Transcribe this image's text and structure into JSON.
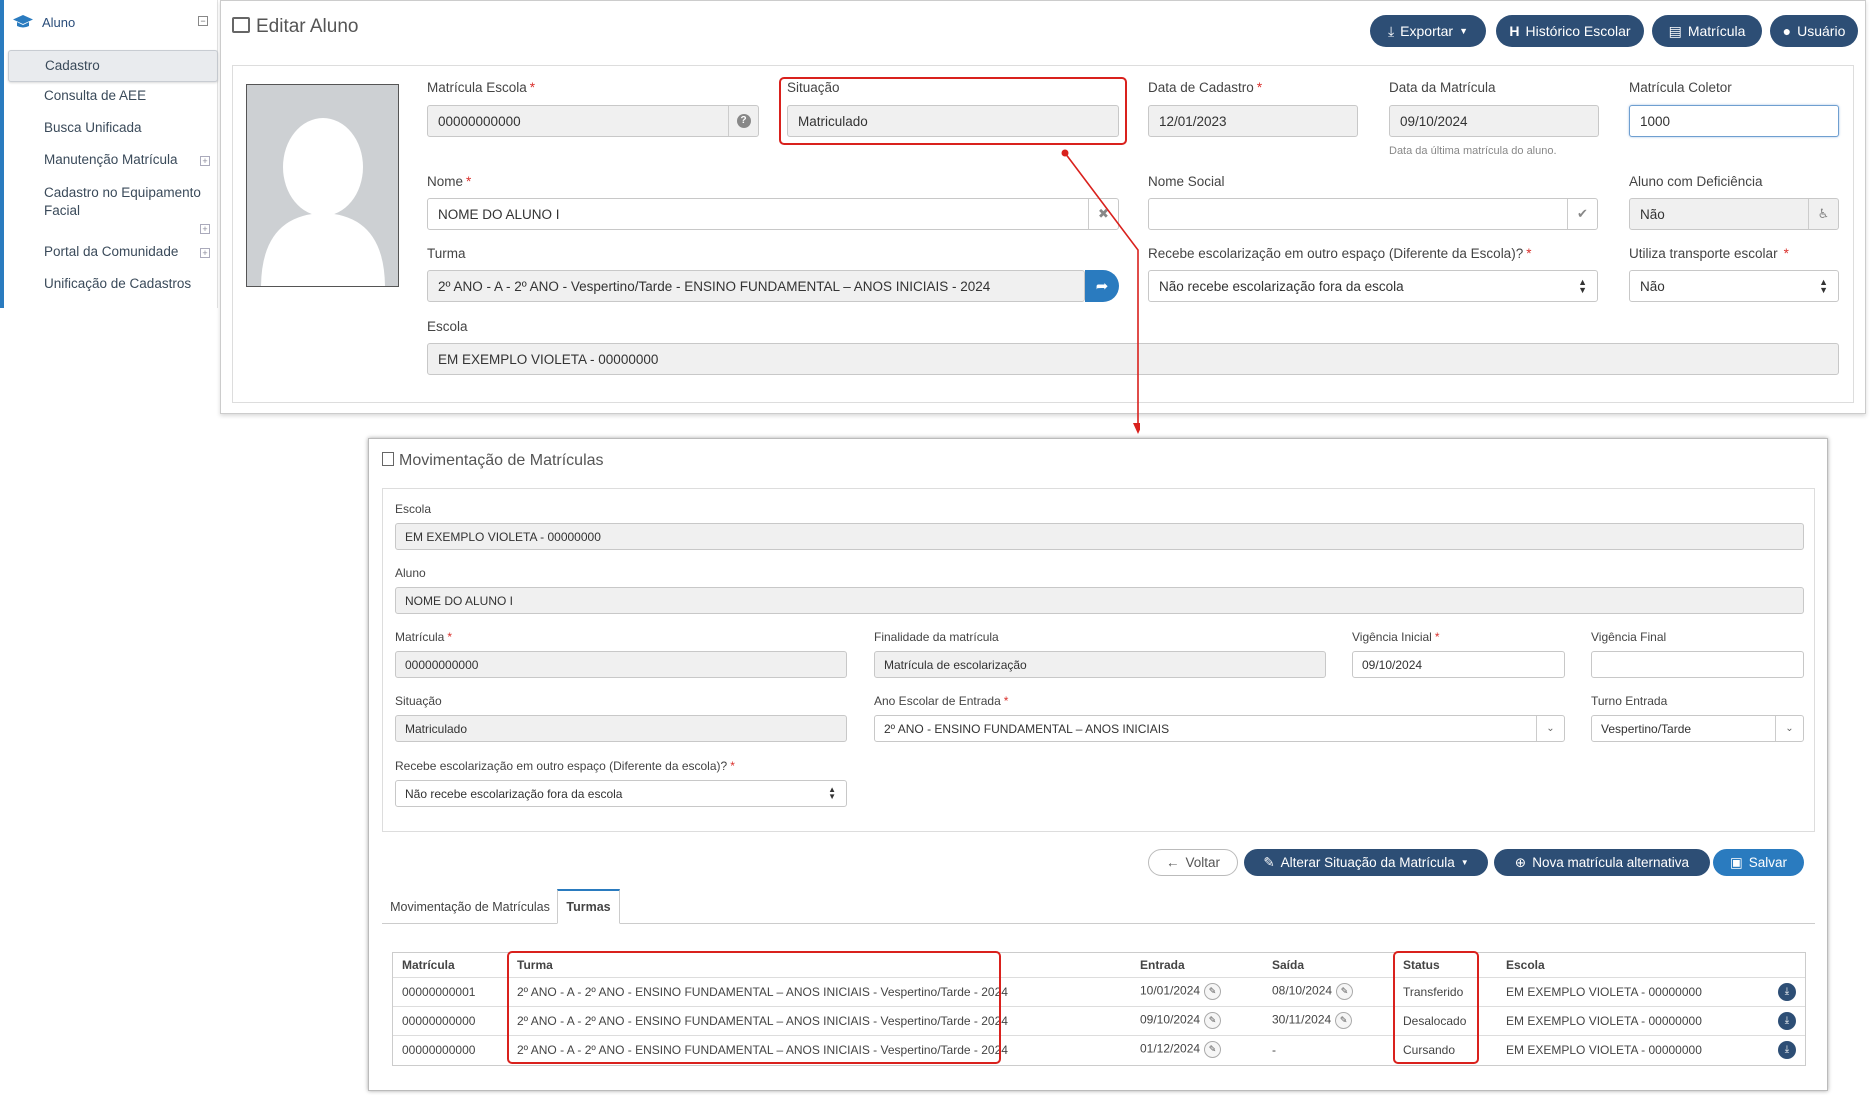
{
  "sidebar": {
    "section_label": "Aluno",
    "items": [
      {
        "label": "Cadastro"
      },
      {
        "label": "Consulta de AEE"
      },
      {
        "label": "Busca Unificada"
      },
      {
        "label": "Manutenção Matrícula"
      },
      {
        "label": "Cadastro no Equipamento"
      },
      {
        "label": "Facial"
      },
      {
        "label": "Portal da Comunidade"
      },
      {
        "label": "Unificação de Cadastros"
      }
    ]
  },
  "editor": {
    "title": "Editar Aluno",
    "buttons": {
      "exportar": "Exportar",
      "historico": "Histórico Escolar",
      "matricula": "Matrícula",
      "usuario": "Usuário"
    },
    "fields": {
      "matricula_escola": {
        "label": "Matrícula Escola",
        "value": "00000000000"
      },
      "situacao": {
        "label": "Situação",
        "value": "Matriculado"
      },
      "data_cadastro": {
        "label": "Data de Cadastro",
        "value": "12/01/2023"
      },
      "data_matricula": {
        "label": "Data da Matrícula",
        "value": "09/10/2024",
        "hint": "Data da última matrícula do aluno."
      },
      "matricula_coletor": {
        "label": "Matrícula Coletor",
        "value": "1000"
      },
      "nome": {
        "label": "Nome",
        "value": "NOME DO ALUNO I"
      },
      "nome_social": {
        "label": "Nome Social",
        "value": ""
      },
      "aluno_deficiencia": {
        "label": "Aluno com Deficiência",
        "value": "Não"
      },
      "turma": {
        "label": "Turma",
        "value": "2º ANO - A - 2º ANO - Vespertino/Tarde - ENSINO FUNDAMENTAL – ANOS INICIAIS - 2024"
      },
      "recebe_escolarizacao": {
        "label": "Recebe escolarização em outro espaço (Diferente da Escola)?",
        "value": "Não recebe escolarização fora da escola"
      },
      "transporte": {
        "label": "Utiliza transporte escolar",
        "value": "Não"
      },
      "escola": {
        "label": "Escola",
        "value": "EM EXEMPLO VIOLETA - 00000000"
      }
    }
  },
  "movimentacao": {
    "title": "Movimentação de Matrículas",
    "fields": {
      "escola": {
        "label": "Escola",
        "value": "EM EXEMPLO VIOLETA - 00000000"
      },
      "aluno": {
        "label": "Aluno",
        "value": "NOME DO ALUNO I"
      },
      "matricula": {
        "label": "Matrícula",
        "value": "00000000000"
      },
      "finalidade": {
        "label": "Finalidade da matrícula",
        "value": "Matrícula de escolarização"
      },
      "vigencia_inicial": {
        "label": "Vigência Inicial",
        "value": "09/10/2024"
      },
      "vigencia_final": {
        "label": "Vigência Final",
        "value": ""
      },
      "situacao": {
        "label": "Situação",
        "value": "Matriculado"
      },
      "ano_escolar": {
        "label": "Ano Escolar de Entrada",
        "value": "2º ANO - ENSINO FUNDAMENTAL – ANOS INICIAIS"
      },
      "turno_entrada": {
        "label": "Turno Entrada",
        "value": "Vespertino/Tarde"
      },
      "recebe_escolarizacao": {
        "label": "Recebe escolarização em outro espaço (Diferente da escola)?",
        "value": "Não recebe escolarização fora da escola"
      }
    },
    "buttons": {
      "voltar": "Voltar",
      "alterar": "Alterar Situação da Matrícula",
      "nova": "Nova matrícula alternativa",
      "salvar": "Salvar"
    },
    "tabs": [
      "Movimentação de Matrículas",
      "Turmas"
    ],
    "table": {
      "headers": [
        "Matrícula",
        "Turma",
        "Entrada",
        "Saída",
        "Status",
        "Escola"
      ],
      "rows": [
        {
          "matricula": "00000000001",
          "turma": "2º ANO - A - 2º ANO - ENSINO FUNDAMENTAL – ANOS INICIAIS - Vespertino/Tarde - 2024",
          "entrada": "10/01/2024",
          "saida": "08/10/2024",
          "status": "Transferido",
          "escola": "EM EXEMPLO VIOLETA - 00000000"
        },
        {
          "matricula": "00000000000",
          "turma": "2º ANO - A - 2º ANO - ENSINO FUNDAMENTAL – ANOS INICIAIS - Vespertino/Tarde - 2024",
          "entrada": "09/10/2024",
          "saida": "30/11/2024",
          "status": "Desalocado",
          "escola": "EM EXEMPLO VIOLETA - 00000000"
        },
        {
          "matricula": "00000000000",
          "turma": "2º ANO - A - 2º ANO - ENSINO FUNDAMENTAL – ANOS INICIAIS - Vespertino/Tarde - 2024",
          "entrada": "01/12/2024",
          "saida": "-",
          "status": "Cursando",
          "escola": "EM EXEMPLO VIOLETA - 00000000"
        }
      ]
    }
  },
  "colors": {
    "navy": "#2d4e75",
    "blue": "#2a7bbf",
    "highlight": "#d9211d"
  }
}
